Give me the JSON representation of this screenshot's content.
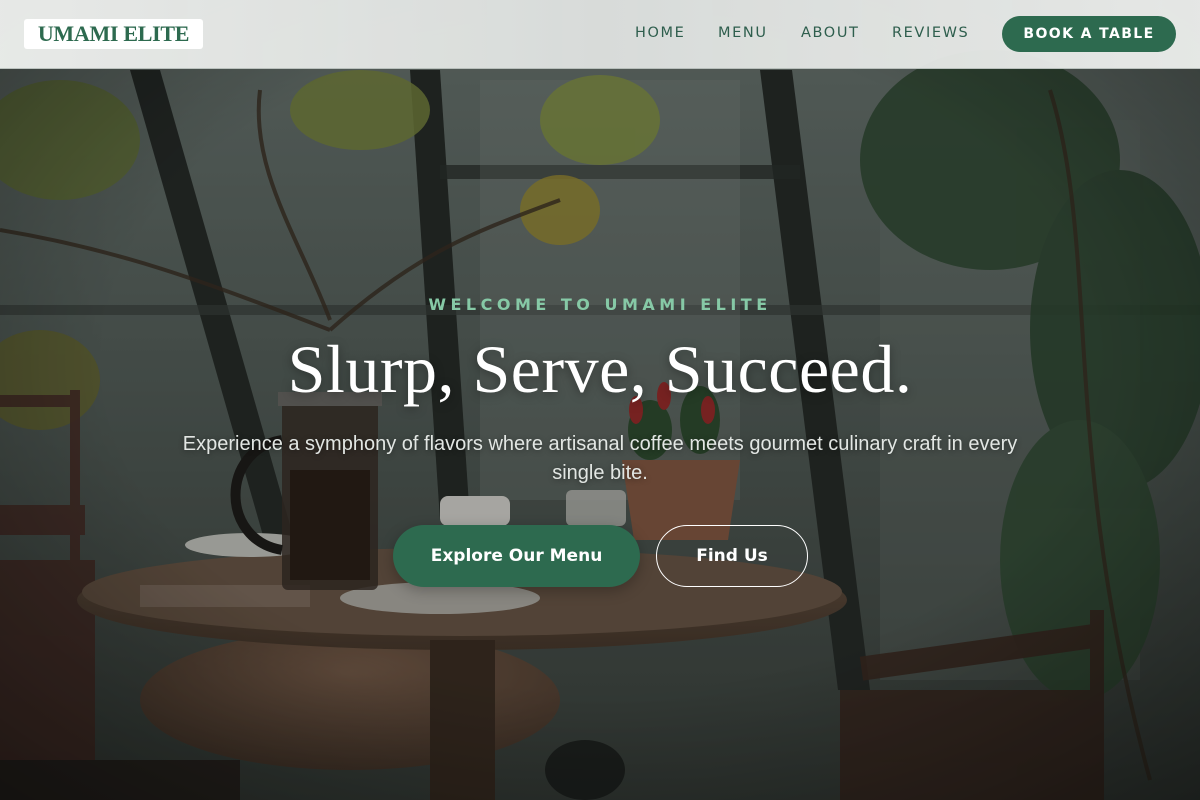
{
  "brand": {
    "name": "UMAMI ELITE",
    "accent_color": "#2d6a4f",
    "eyebrow_color": "#86c9a6"
  },
  "nav": {
    "links": [
      "HOME",
      "MENU",
      "ABOUT",
      "REVIEWS"
    ],
    "cta_label": "BOOK A TABLE"
  },
  "hero": {
    "eyebrow": "WELCOME TO UMAMI ELITE",
    "headline": "Slurp, Serve, Succeed.",
    "subtitle": "Experience a symphony of flavors where artisanal coffee meets gourmet culinary craft in every single bite.",
    "primary_button": "Explore Our Menu",
    "secondary_button": "Find Us",
    "background_image": "cafe-interior-photo"
  }
}
